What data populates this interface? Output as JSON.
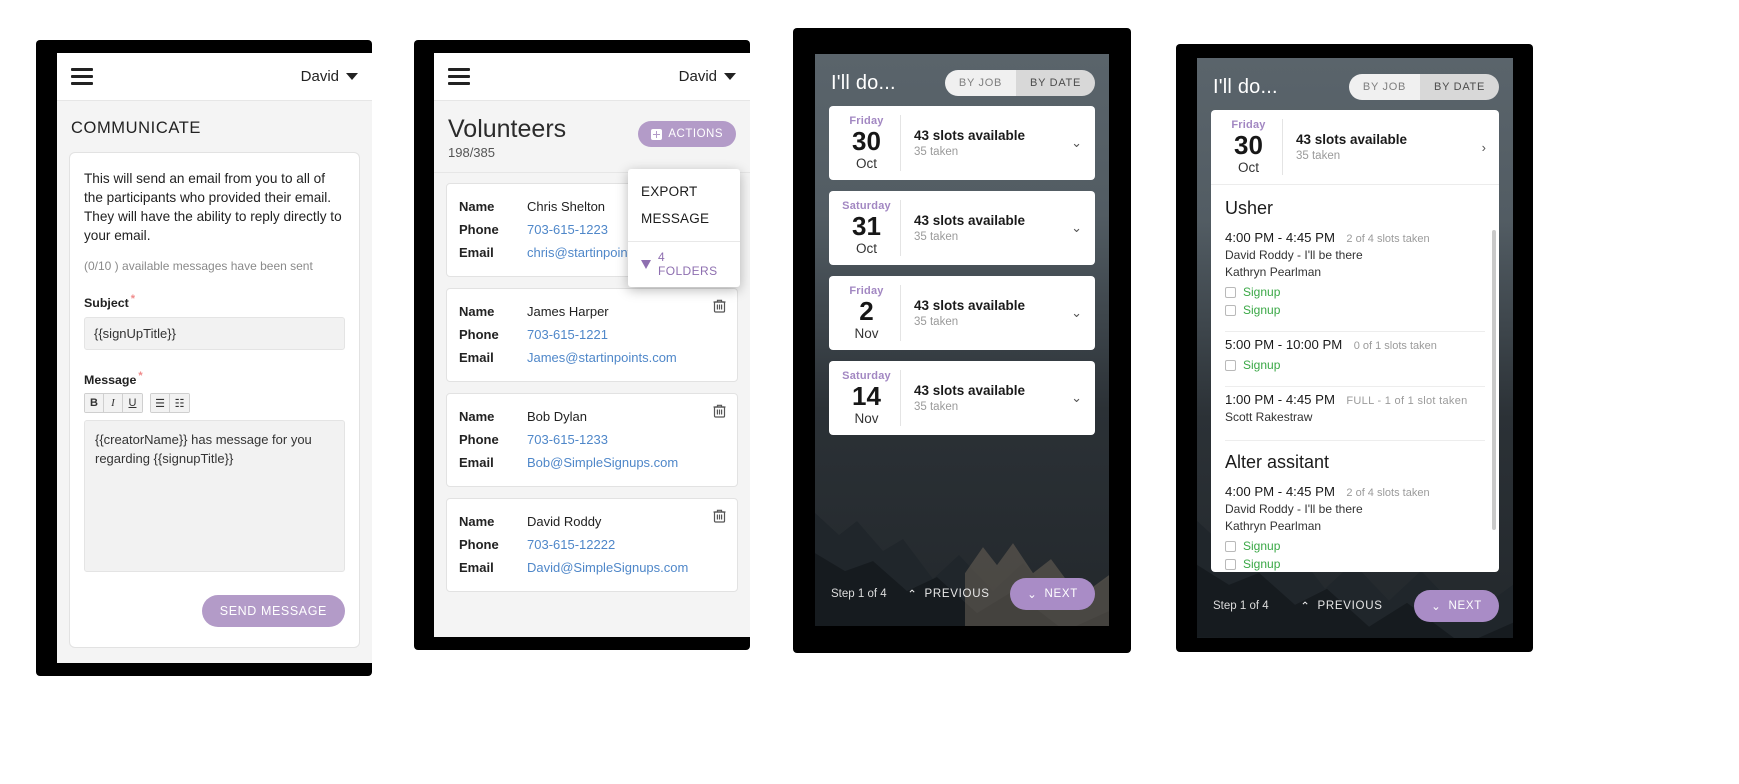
{
  "panel1": {
    "appbar": {
      "menu_icon": "hamburger-icon",
      "user": "David",
      "caret_icon": "chevron-down-icon"
    },
    "page_title": "COMMUNICATE",
    "intro": "This will send an email from you to all of the participants who provided their email. They will have the ability to reply directly to your email.",
    "sent_note": "(0/10 ) available messages have been sent",
    "subject_label": "Subject",
    "subject_value": "{{signUpTitle}}",
    "subject_placeholder": "Subject",
    "message_label": "Message",
    "message_value": "{{creatorName}} has message for you regarding {{signupTitle}}",
    "message_placeholder": "Message",
    "required_mark": "*",
    "toolbar": [
      {
        "name": "bold-button",
        "label": "B"
      },
      {
        "name": "italic-button",
        "label": "I"
      },
      {
        "name": "underline-button",
        "label": "U"
      },
      {
        "name": "bullet-list-button",
        "label": "☰"
      },
      {
        "name": "numbered-list-button",
        "label": "☷"
      }
    ],
    "send_label": "SEND MESSAGE"
  },
  "panel2": {
    "appbar": {
      "menu_icon": "hamburger-icon",
      "user": "David",
      "caret_icon": "chevron-down-icon"
    },
    "title": "Volunteers",
    "counter": "198/385",
    "actions_label": "ACTIONS",
    "dropdown": {
      "items": [
        "EXPORT",
        "MESSAGE"
      ],
      "folders_label": "4 FOLDERS",
      "filter_icon": "funnel-icon"
    },
    "labels": {
      "name": "Name",
      "phone": "Phone",
      "email": "Email"
    },
    "volunteers": [
      {
        "name": "Chris Shelton",
        "phone": "703-615-1223",
        "email": "chris@startinpoints.com",
        "deletable": false
      },
      {
        "name": "James Harper",
        "phone": "703-615-1221",
        "email": "James@startinpoints.com",
        "deletable": true
      },
      {
        "name": "Bob Dylan",
        "phone": "703-615-1233",
        "email": "Bob@SimpleSignups.com",
        "deletable": true
      },
      {
        "name": "David Roddy",
        "phone": "703-615-12222",
        "email": "David@SimpleSignups.com",
        "deletable": true
      }
    ]
  },
  "panel3": {
    "title": "I'll do...",
    "segments": [
      {
        "label": "BY JOB",
        "active": false
      },
      {
        "label": "BY DATE",
        "active": true
      }
    ],
    "dates": [
      {
        "dow": "Friday",
        "day": "30",
        "month": "Oct",
        "slots": "43 slots available",
        "taken": "35 taken",
        "caret": "chevron-down-icon"
      },
      {
        "dow": "Saturday",
        "day": "31",
        "month": "Oct",
        "slots": "43 slots available",
        "taken": "35 taken",
        "caret": "chevron-down-icon"
      },
      {
        "dow": "Friday",
        "day": "2",
        "month": "Nov",
        "slots": "43 slots available",
        "taken": "35 taken",
        "caret": "chevron-down-icon"
      },
      {
        "dow": "Saturday",
        "day": "14",
        "month": "Nov",
        "slots": "43 slots available",
        "taken": "35 taken",
        "caret": "chevron-down-icon"
      }
    ],
    "footer": {
      "step": "Step 1 of 4",
      "previous": "PREVIOUS",
      "next": "NEXT"
    }
  },
  "panel4": {
    "title": "I'll do...",
    "segments": [
      {
        "label": "BY JOB",
        "active": false
      },
      {
        "label": "BY DATE",
        "active": true
      }
    ],
    "header_date": {
      "dow": "Friday",
      "day": "30",
      "month": "Oct",
      "slots": "43 slots available",
      "taken": "35 taken",
      "caret": "chevron-right-icon"
    },
    "jobs": [
      {
        "name": "Usher",
        "slots": [
          {
            "time": "4:00 PM -  4:45 PM",
            "meta": "2 of 4 slots taken",
            "people": [
              "David Roddy - I'll be there",
              "Kathryn Pearlman"
            ],
            "signups": [
              "Signup",
              "Signup"
            ]
          },
          {
            "time": "5:00 PM -  10:00 PM",
            "meta": "0 of 1 slots taken",
            "people": [],
            "signups": [
              "Signup"
            ]
          },
          {
            "time": "1:00 PM -  4:45 PM",
            "meta": "FULL - 1 of 1 slot taken",
            "people": [
              "Scott Rakestraw"
            ],
            "signups": []
          }
        ]
      },
      {
        "name": "Alter assitant",
        "slots": [
          {
            "time": "4:00 PM -  4:45 PM",
            "meta": "2 of 4 slots taken",
            "people": [
              "David Roddy - I'll be there",
              "Kathryn Pearlman"
            ],
            "signups": [
              "Signup",
              "Signup"
            ]
          }
        ]
      }
    ],
    "footer": {
      "step": "Step 1 of 4",
      "previous": "PREVIOUS",
      "next": "NEXT"
    }
  },
  "colors": {
    "accent_purple": "#b39bc8",
    "link_blue": "#4f87c9",
    "signup_green": "#3aa846",
    "dow_purple": "#a287c2"
  }
}
